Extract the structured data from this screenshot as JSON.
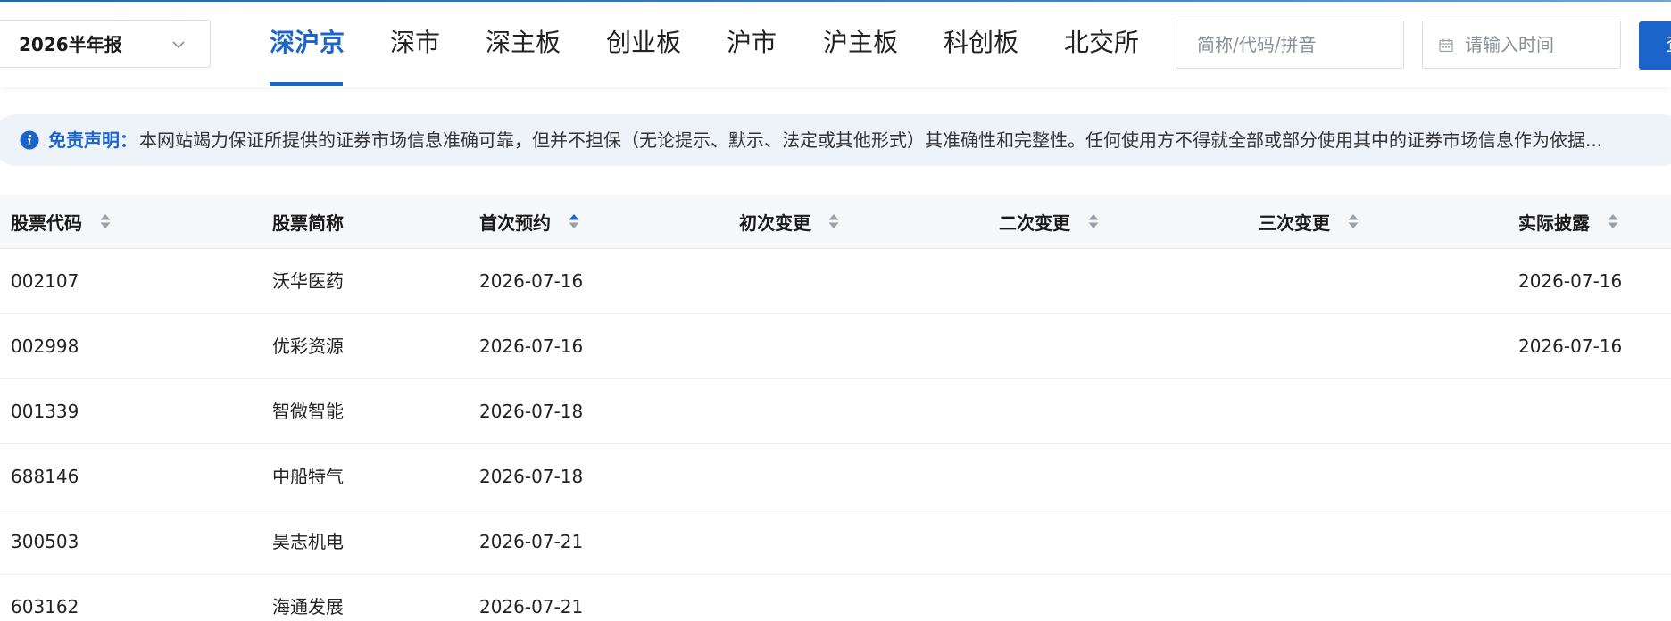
{
  "toolbar": {
    "period": "2026半年报",
    "tabs": [
      {
        "label": "深沪京",
        "active": true
      },
      {
        "label": "深市"
      },
      {
        "label": "深主板"
      },
      {
        "label": "创业板"
      },
      {
        "label": "沪市"
      },
      {
        "label": "沪主板"
      },
      {
        "label": "科创板"
      },
      {
        "label": "北交所"
      }
    ],
    "search_placeholder": "简称/代码/拼音",
    "date_placeholder": "请输入时间",
    "query_label": "查询",
    "accent_color": "#1b64c9"
  },
  "notice": {
    "title": "免责声明：",
    "body": "本网站竭力保证所提供的证券市场信息准确可靠，但并不担保（无论提示、默示、法定或其他形式）其准确性和完整性。任何使用方不得就全部或部分使用其中的证券市场信息作为依据..."
  },
  "table": {
    "columns": [
      {
        "label": "股票代码",
        "sortable": true,
        "sort": "none"
      },
      {
        "label": "股票简称",
        "sortable": false
      },
      {
        "label": "首次预约",
        "sortable": true,
        "sort": "asc"
      },
      {
        "label": "初次变更",
        "sortable": true,
        "sort": "none"
      },
      {
        "label": "二次变更",
        "sortable": true,
        "sort": "none"
      },
      {
        "label": "三次变更",
        "sortable": true,
        "sort": "none"
      },
      {
        "label": "实际披露",
        "sortable": true,
        "sort": "none"
      }
    ],
    "rows": [
      [
        "002107",
        "沃华医药",
        "2026-07-16",
        "",
        "",
        "",
        "2026-07-16"
      ],
      [
        "002998",
        "优彩资源",
        "2026-07-16",
        "",
        "",
        "",
        "2026-07-16"
      ],
      [
        "001339",
        "智微智能",
        "2026-07-18",
        "",
        "",
        "",
        ""
      ],
      [
        "688146",
        "中船特气",
        "2026-07-18",
        "",
        "",
        "",
        ""
      ],
      [
        "300503",
        "昊志机电",
        "2026-07-21",
        "",
        "",
        "",
        ""
      ],
      [
        "603162",
        "海通发展",
        "2026-07-21",
        "",
        "",
        "",
        ""
      ]
    ]
  }
}
